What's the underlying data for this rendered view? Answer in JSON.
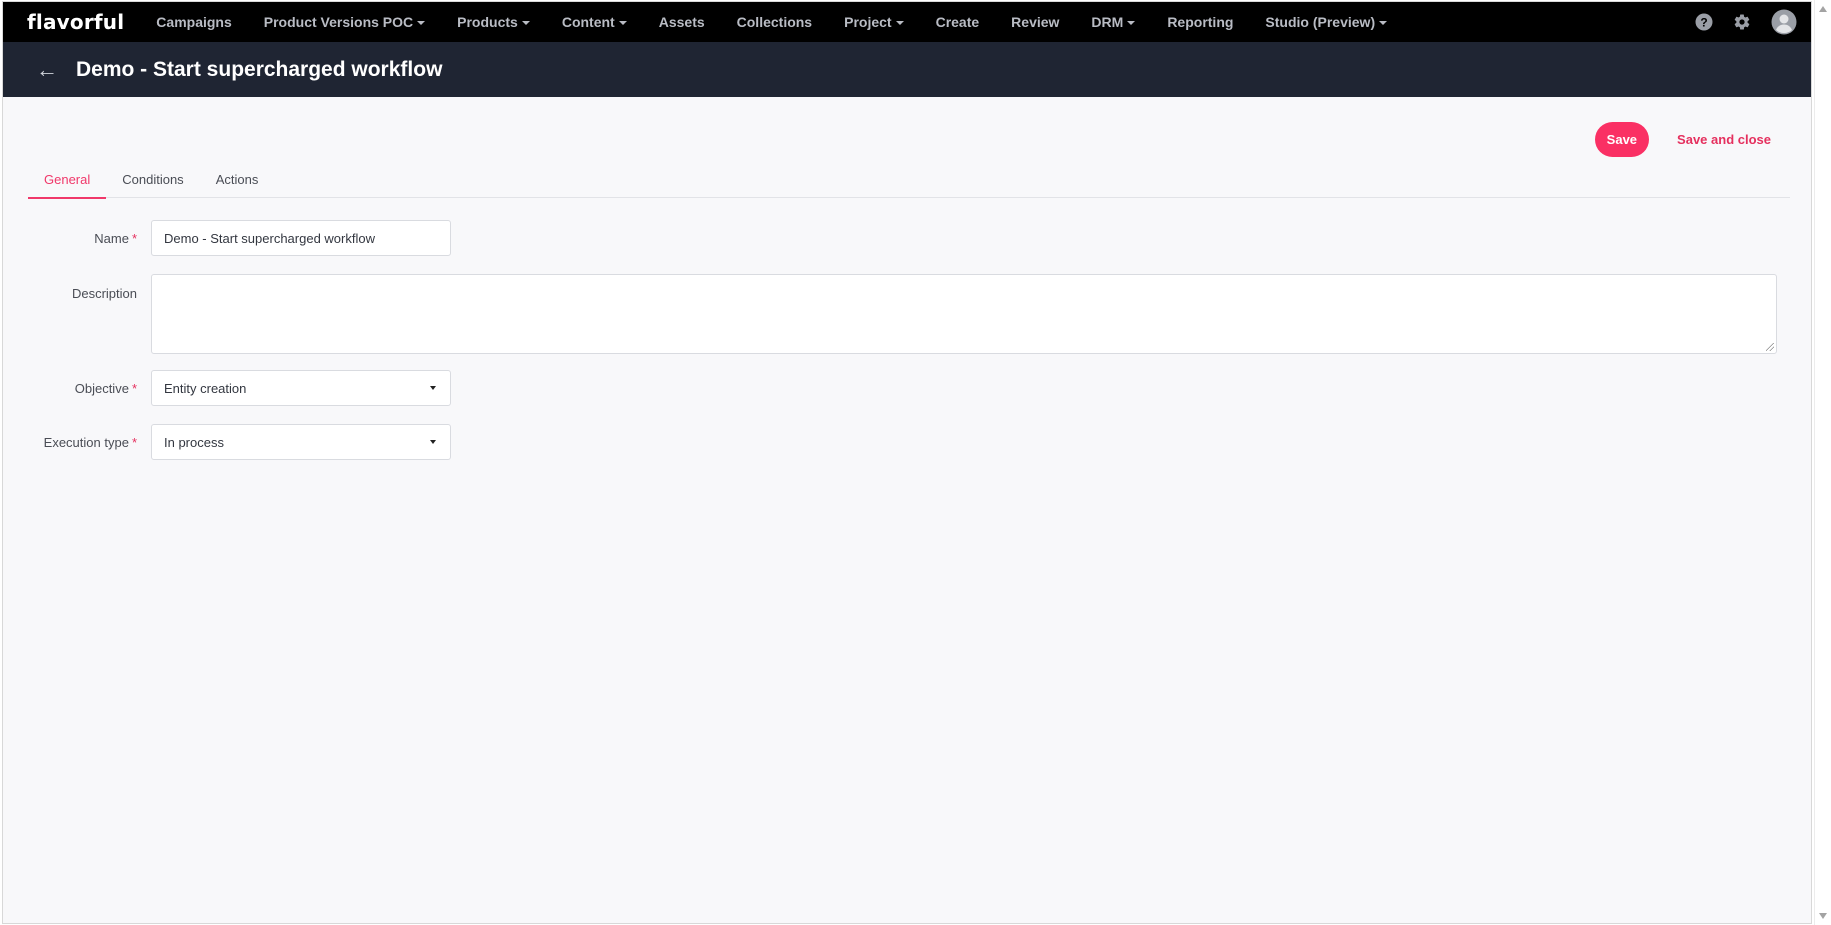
{
  "brand": {
    "logo": "flavorful",
    "accent": "#fa3064",
    "nav_bg": "#000000",
    "header_bg": "#1f2533"
  },
  "topnav": {
    "items": [
      {
        "label": "Campaigns",
        "dropdown": false
      },
      {
        "label": "Product Versions POC",
        "dropdown": true
      },
      {
        "label": "Products",
        "dropdown": true
      },
      {
        "label": "Content",
        "dropdown": true
      },
      {
        "label": "Assets",
        "dropdown": false
      },
      {
        "label": "Collections",
        "dropdown": false
      },
      {
        "label": "Project",
        "dropdown": true
      },
      {
        "label": "Create",
        "dropdown": false
      },
      {
        "label": "Review",
        "dropdown": false
      },
      {
        "label": "DRM",
        "dropdown": true
      },
      {
        "label": "Reporting",
        "dropdown": false
      },
      {
        "label": "Studio (Preview)",
        "dropdown": true
      }
    ],
    "icons": [
      "help-icon",
      "gear-icon",
      "avatar-icon"
    ]
  },
  "header": {
    "back_icon": "arrow-left-icon",
    "title": "Demo - Start supercharged workflow"
  },
  "actions": {
    "save_label": "Save",
    "save_close_label": "Save and close"
  },
  "tabs": [
    {
      "label": "General",
      "active": true
    },
    {
      "label": "Conditions",
      "active": false
    },
    {
      "label": "Actions",
      "active": false
    }
  ],
  "form": {
    "required_marker": "*",
    "name": {
      "label": "Name",
      "value": "Demo - Start supercharged workflow",
      "required": true
    },
    "description": {
      "label": "Description",
      "value": "",
      "required": false
    },
    "objective": {
      "label": "Objective",
      "value": "Entity creation",
      "required": true
    },
    "execution_type": {
      "label": "Execution type",
      "value": "In process",
      "required": true
    }
  }
}
